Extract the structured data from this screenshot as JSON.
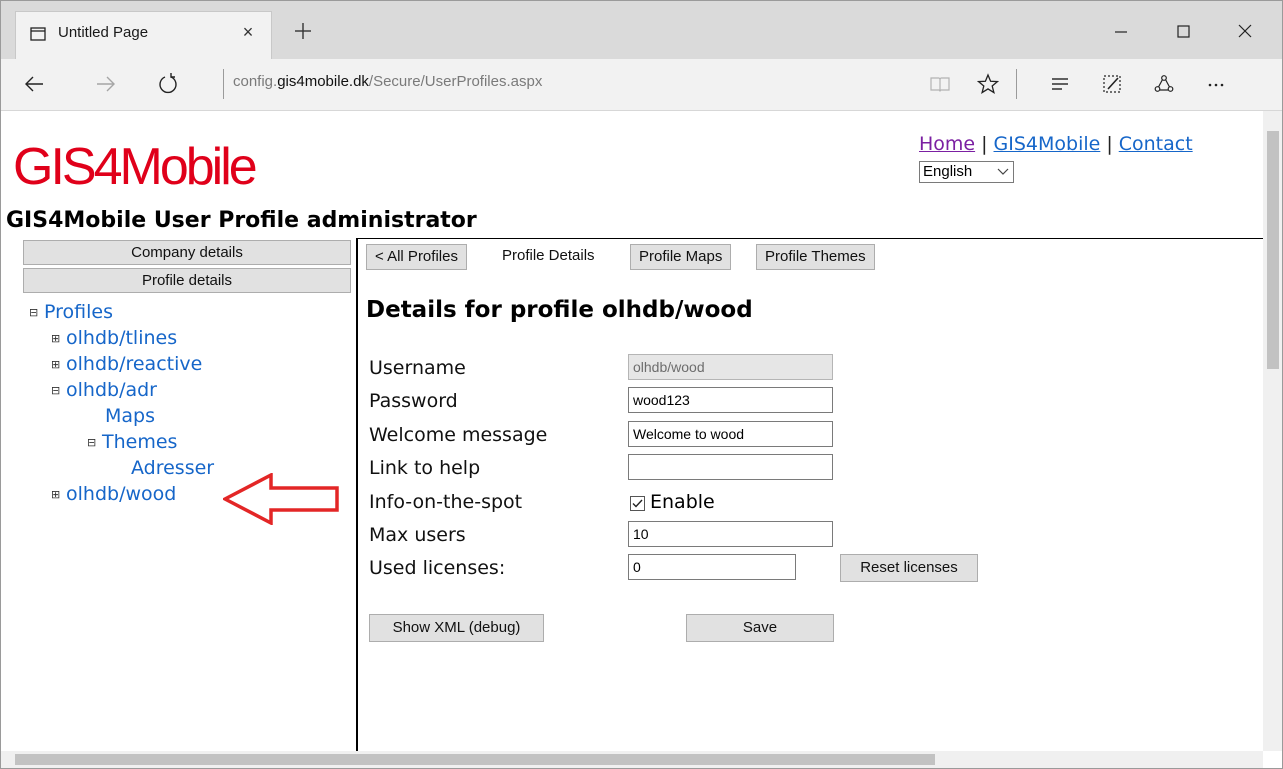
{
  "browser": {
    "tab_title": "Untitled Page",
    "url_prefix": "config.",
    "url_domain": "gis4mobile.dk",
    "url_path": "/Secure/UserProfiles.aspx"
  },
  "header": {
    "logo_text": "GIS4Mobile",
    "links": {
      "home": "Home",
      "gis4mobile": "GIS4Mobile",
      "contact": "Contact",
      "separator": "|"
    },
    "language": "English",
    "page_title": "GIS4Mobile User Profile administrator"
  },
  "sidebar": {
    "company_details_label": "Company details",
    "profile_details_label": "Profile details",
    "tree": {
      "expanded_symbol": "⊟",
      "collapsed_symbol": "⊞",
      "profiles": "Profiles",
      "tlines": "olhdb/tlines",
      "reactive": "olhdb/reactive",
      "adr": "olhdb/adr",
      "maps": "Maps",
      "themes": "Themes",
      "adresser": "Adresser",
      "wood": "olhdb/wood"
    }
  },
  "tabs": {
    "all_profiles": "< All Profiles",
    "profile_details": "Profile Details",
    "profile_maps": "Profile Maps",
    "profile_themes": "Profile Themes"
  },
  "details": {
    "heading": "Details for profile  olhdb/wood",
    "labels": {
      "username": "Username",
      "password": "Password",
      "welcome": "Welcome message",
      "help_link": "Link to help",
      "info_spot": "Info-on-the-spot",
      "max_users": "Max users",
      "used_licenses": "Used licenses:"
    },
    "values": {
      "username": "olhdb/wood",
      "password": "wood123",
      "welcome": "Welcome to wood",
      "help_link": "",
      "max_users": "10",
      "used_licenses": "0"
    },
    "enable_label": "Enable",
    "enable_checked": true,
    "reset_licenses_label": "Reset licenses",
    "show_xml_label": "Show XML (debug)",
    "save_label": "Save"
  },
  "colors": {
    "logo": "#e0001a",
    "link": "#1666c9",
    "visited_link": "#7b1fa2",
    "annotation_arrow": "#e32626"
  }
}
